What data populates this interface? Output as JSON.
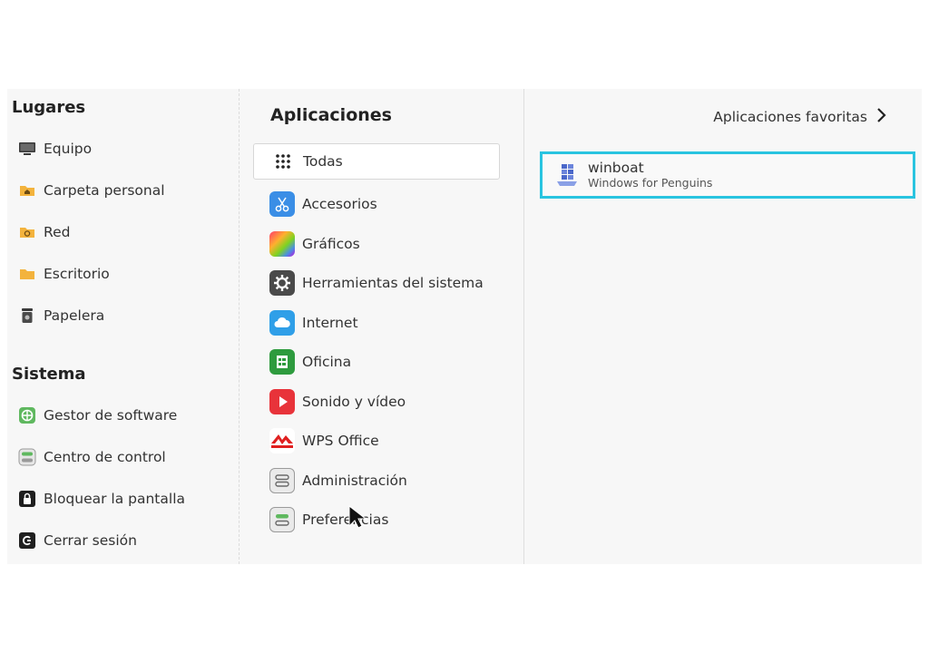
{
  "places": {
    "title": "Lugares",
    "items": [
      {
        "label": "Equipo",
        "icon": "computer-icon"
      },
      {
        "label": "Carpeta personal",
        "icon": "home-folder-icon"
      },
      {
        "label": "Red",
        "icon": "network-folder-icon"
      },
      {
        "label": "Escritorio",
        "icon": "desktop-folder-icon"
      },
      {
        "label": "Papelera",
        "icon": "trash-icon"
      }
    ]
  },
  "system": {
    "title": "Sistema",
    "items": [
      {
        "label": "Gestor de software",
        "icon": "software-manager-icon"
      },
      {
        "label": "Centro de control",
        "icon": "control-center-icon"
      },
      {
        "label": "Bloquear la pantalla",
        "icon": "lock-icon"
      },
      {
        "label": "Cerrar sesión",
        "icon": "logout-icon"
      }
    ]
  },
  "applications": {
    "title": "Aplicaciones",
    "favorites_label": "Aplicaciones favoritas",
    "categories": [
      {
        "label": "Todas",
        "icon": "grid-icon",
        "selected": true
      },
      {
        "label": "Accesorios",
        "icon": "scissors-icon"
      },
      {
        "label": "Gráficos",
        "icon": "graphics-icon"
      },
      {
        "label": "Herramientas del sistema",
        "icon": "gear-icon"
      },
      {
        "label": "Internet",
        "icon": "cloud-icon"
      },
      {
        "label": "Oficina",
        "icon": "office-icon"
      },
      {
        "label": "Sonido y vídeo",
        "icon": "play-icon"
      },
      {
        "label": "WPS Office",
        "icon": "wps-icon"
      },
      {
        "label": "Administración",
        "icon": "toggle-icon"
      },
      {
        "label": "Preferencias",
        "icon": "preferences-icon"
      }
    ],
    "apps": [
      {
        "name": "winboat",
        "description": "Windows for Penguins",
        "icon": "winboat-icon"
      }
    ]
  },
  "colors": {
    "highlight_border": "#29c4e0",
    "panel_background": "#f7f7f7"
  }
}
